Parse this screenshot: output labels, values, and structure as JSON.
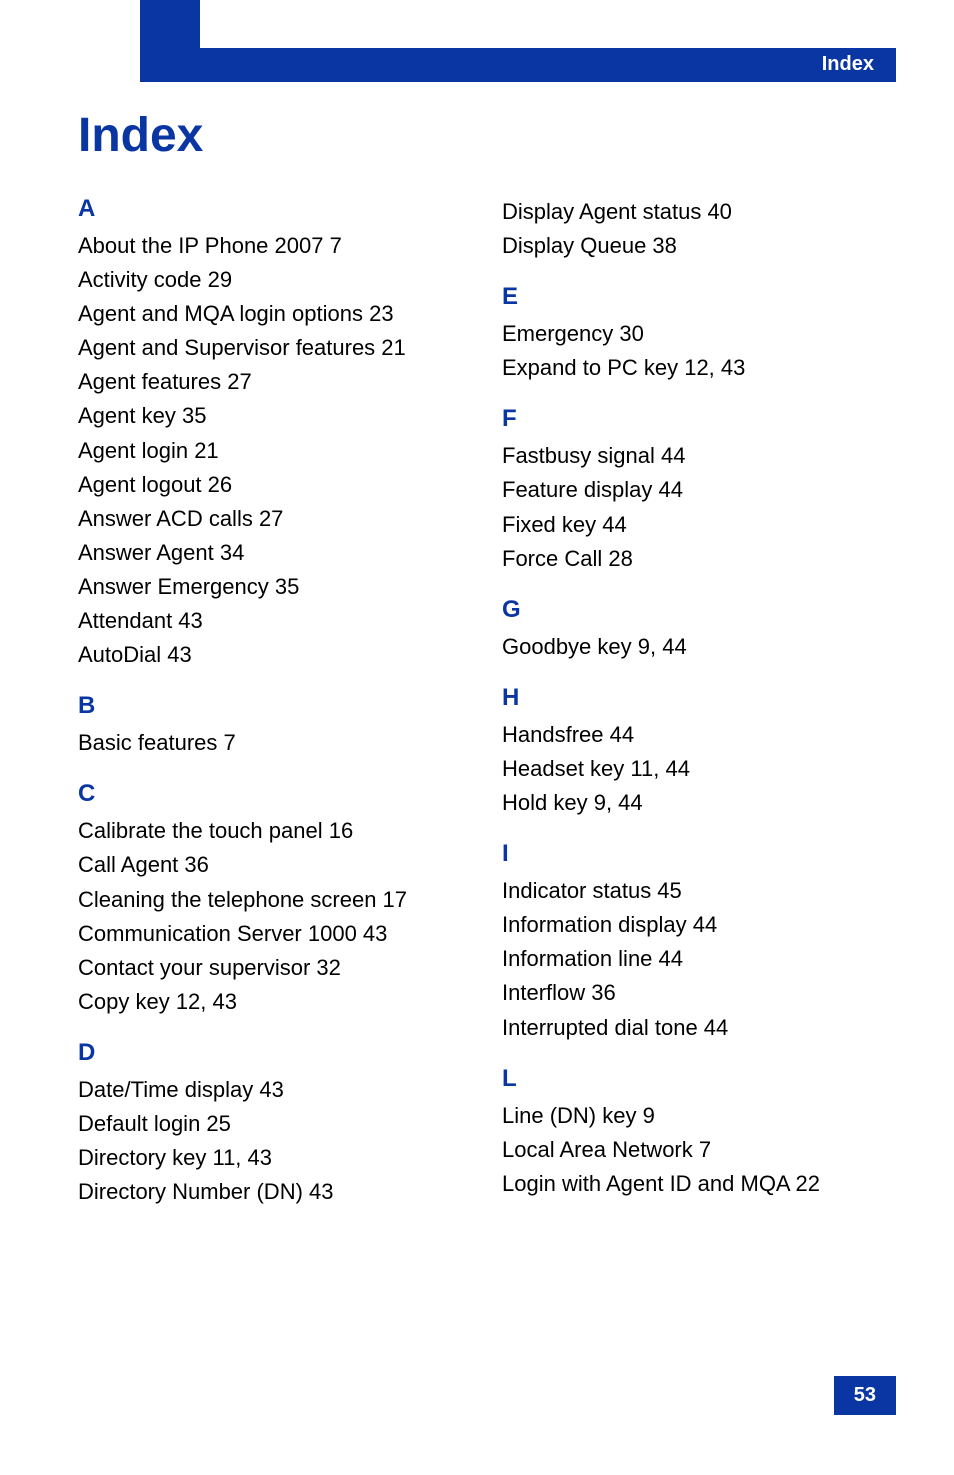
{
  "header": {
    "label": "Index"
  },
  "title": "Index",
  "page_number": "53",
  "left_column": {
    "sections": [
      {
        "letter": "A",
        "entries": [
          "About the IP Phone 2007 7",
          "Activity code 29",
          "Agent and MQA login options 23",
          "Agent and Supervisor features 21",
          "Agent features 27",
          "Agent key 35",
          "Agent login 21",
          "Agent logout 26",
          "Answer ACD calls 27",
          "Answer Agent 34",
          "Answer Emergency 35",
          "Attendant 43",
          "AutoDial 43"
        ]
      },
      {
        "letter": "B",
        "entries": [
          "Basic features 7"
        ]
      },
      {
        "letter": "C",
        "entries": [
          "Calibrate the touch panel 16",
          "Call Agent 36",
          "Cleaning the telephone screen 17",
          "Communication Server 1000 43",
          "Contact your supervisor 32",
          "Copy key 12, 43"
        ]
      },
      {
        "letter": "D",
        "entries": [
          "Date/Time display 43",
          "Default login 25",
          "Directory key 11, 43",
          "Directory Number (DN) 43"
        ]
      }
    ]
  },
  "right_column": {
    "top_entries": [
      "Display Agent status 40",
      "Display Queue 38"
    ],
    "sections": [
      {
        "letter": "E",
        "entries": [
          "Emergency 30",
          "Expand to PC key 12, 43"
        ]
      },
      {
        "letter": "F",
        "entries": [
          "Fastbusy signal 44",
          "Feature display 44",
          "Fixed key 44",
          "Force Call 28"
        ]
      },
      {
        "letter": "G",
        "entries": [
          "Goodbye key 9, 44"
        ]
      },
      {
        "letter": "H",
        "entries": [
          "Handsfree 44",
          "Headset key 11, 44",
          "Hold key 9, 44"
        ]
      },
      {
        "letter": "I",
        "entries": [
          "Indicator status 45",
          "Information display 44",
          "Information line 44",
          "Interflow 36",
          "Interrupted dial tone 44"
        ]
      },
      {
        "letter": "L",
        "entries": [
          "Line (DN) key 9",
          "Local Area Network 7",
          "Login with Agent ID and MQA 22"
        ]
      }
    ]
  }
}
